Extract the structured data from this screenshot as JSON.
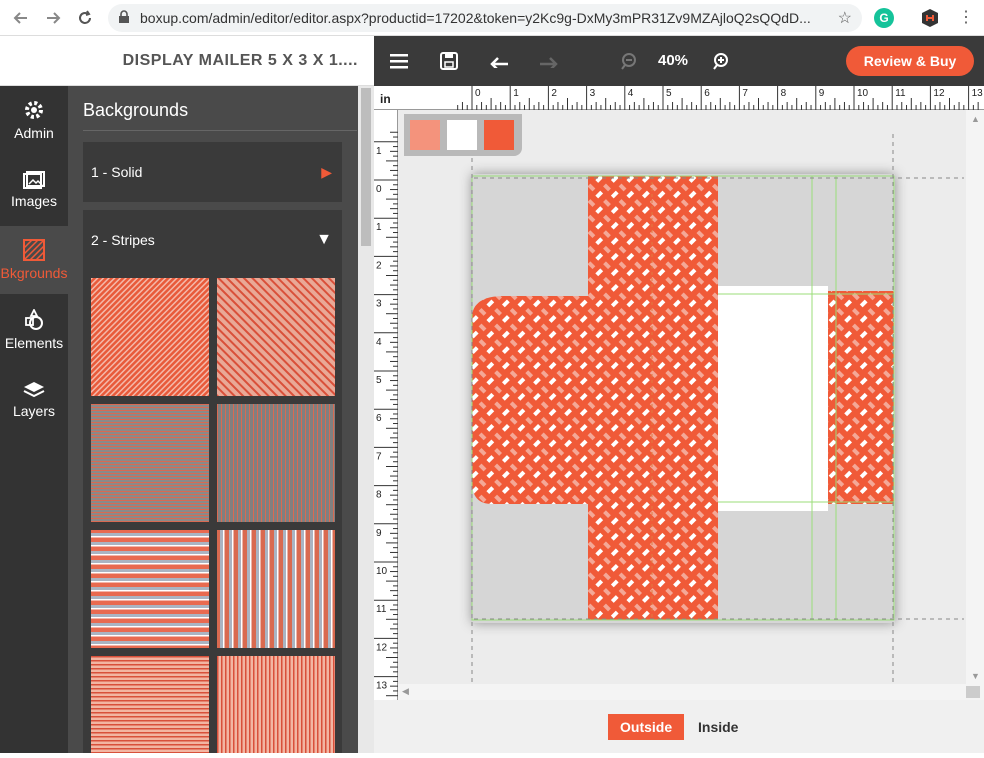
{
  "browser": {
    "url": "boxup.com/admin/editor/editor.aspx?productid=17202&token=y2Kc9g-DxMy3mPR31Zv9MZAjloQ2sQQdD...",
    "ext1": "G"
  },
  "document": {
    "title": "DISPLAY MAILER 5 X 3 X 1...."
  },
  "toolbar": {
    "zoom": "40%",
    "review_label": "Review & Buy"
  },
  "sidebar": {
    "items": [
      {
        "label": "Admin",
        "icon": "gear-icon"
      },
      {
        "label": "Images",
        "icon": "images-icon"
      },
      {
        "label": "Bkgrounds",
        "icon": "backgrounds-icon"
      },
      {
        "label": "Elements",
        "icon": "elements-icon"
      },
      {
        "label": "Layers",
        "icon": "layers-icon"
      }
    ]
  },
  "panel": {
    "title": "Backgrounds",
    "sections": [
      {
        "label": "1 - Solid",
        "state": "collapsed"
      },
      {
        "label": "2 - Stripes",
        "state": "expanded"
      }
    ]
  },
  "canvas": {
    "unit": "in",
    "ruler_top": [
      "0",
      "1",
      "2",
      "3",
      "4",
      "5",
      "6",
      "7",
      "8",
      "9",
      "10",
      "11",
      "12",
      "13"
    ],
    "ruler_left": [
      "1",
      "0",
      "1",
      "2",
      "3",
      "4",
      "5",
      "6",
      "7",
      "8",
      "9",
      "10",
      "11",
      "12",
      "13"
    ],
    "colors": [
      "#f4937c",
      "#ffffff",
      "#f05a38"
    ]
  },
  "tabs": {
    "outside": "Outside",
    "inside": "Inside"
  },
  "colors": {
    "accent": "#f05a38",
    "dark": "#333333",
    "panel": "#4a4a4a"
  }
}
